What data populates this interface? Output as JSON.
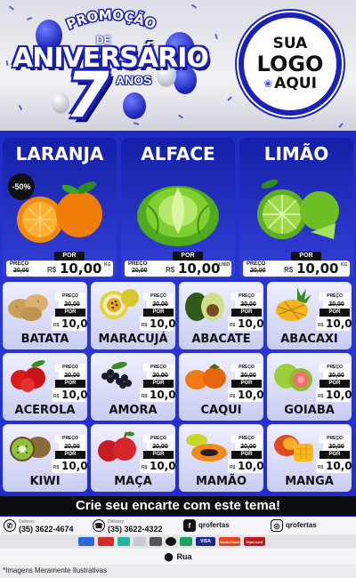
{
  "header": {
    "promo_top": "PROMOÇÃO",
    "promo_de": "DE",
    "promo_main": "ANIVERSÁRIO",
    "promo_number": "7",
    "promo_anos": "ANOS",
    "logo_line1": "SUA",
    "logo_line2": "LOGO",
    "logo_line3": "AQUI"
  },
  "featured": [
    {
      "name": "LARANJA",
      "discount": "-50%",
      "por": "POR",
      "preco": "PREÇO",
      "old": "20,00",
      "rs": "R$",
      "price": "10,00",
      "unit": "KG"
    },
    {
      "name": "ALFACE",
      "discount": "",
      "por": "POR",
      "preco": "PREÇO",
      "old": "20,00",
      "rs": "R$",
      "price": "10,00",
      "unit": "UNID"
    },
    {
      "name": "LIMÃO",
      "discount": "",
      "por": "POR",
      "preco": "PREÇO",
      "old": "20,00",
      "rs": "R$",
      "price": "10,00",
      "unit": "KG"
    }
  ],
  "products": [
    {
      "name": "BATATA",
      "preco": "PREÇO",
      "old": "20,00",
      "por": "POR",
      "rs": "R$",
      "price": "10,00"
    },
    {
      "name": "MARACUJÁ",
      "preco": "PREÇO",
      "old": "20,00",
      "por": "POR",
      "rs": "R$",
      "price": "10,00"
    },
    {
      "name": "ABACATE",
      "preco": "PREÇO",
      "old": "20,00",
      "por": "POR",
      "rs": "R$",
      "price": "10,00"
    },
    {
      "name": "ABACAXI",
      "preco": "PREÇO",
      "old": "20,00",
      "por": "POR",
      "rs": "R$",
      "price": "10,00"
    },
    {
      "name": "ACEROLA",
      "preco": "PREÇO",
      "old": "20,00",
      "por": "POR",
      "rs": "R$",
      "price": "10,00"
    },
    {
      "name": "AMORA",
      "preco": "PREÇO",
      "old": "20,00",
      "por": "POR",
      "rs": "R$",
      "price": "10,00"
    },
    {
      "name": "CAQUI",
      "preco": "PREÇO",
      "old": "20,00",
      "por": "POR",
      "rs": "R$",
      "price": "10,00"
    },
    {
      "name": "GOIABA",
      "preco": "PREÇO",
      "old": "20,00",
      "por": "POR",
      "rs": "R$",
      "price": "10,00"
    },
    {
      "name": "KIWI",
      "preco": "PREÇO",
      "old": "20,00",
      "por": "POR",
      "rs": "R$",
      "price": "10,00"
    },
    {
      "name": "MAÇA",
      "preco": "PREÇO",
      "old": "20,00",
      "por": "POR",
      "rs": "R$",
      "price": "10,00"
    },
    {
      "name": "MAMÃO",
      "preco": "PREÇO",
      "old": "20,00",
      "por": "POR",
      "rs": "R$",
      "price": "10,00"
    },
    {
      "name": "MANGA",
      "preco": "PREÇO",
      "old": "20,00",
      "por": "POR",
      "rs": "R$",
      "price": "10,00"
    }
  ],
  "footer": {
    "cta": "Crie seu encarte com este tema!",
    "contact1_label": "Delivery",
    "contact1_phone": "(35) 3622-4674",
    "contact2_label": "Delivery",
    "contact2_phone": "(35) 3622-4322",
    "facebook": "qrofertas",
    "instagram": "qrofertas",
    "payments": [
      "VISA",
      "MasterCard",
      "Hipercard"
    ],
    "address": "Rua",
    "disclaimer": "*Imagens Meramente Ilustrativas"
  },
  "colors": {
    "brand_blue": "#1e2bc4",
    "dark": "#111111"
  }
}
